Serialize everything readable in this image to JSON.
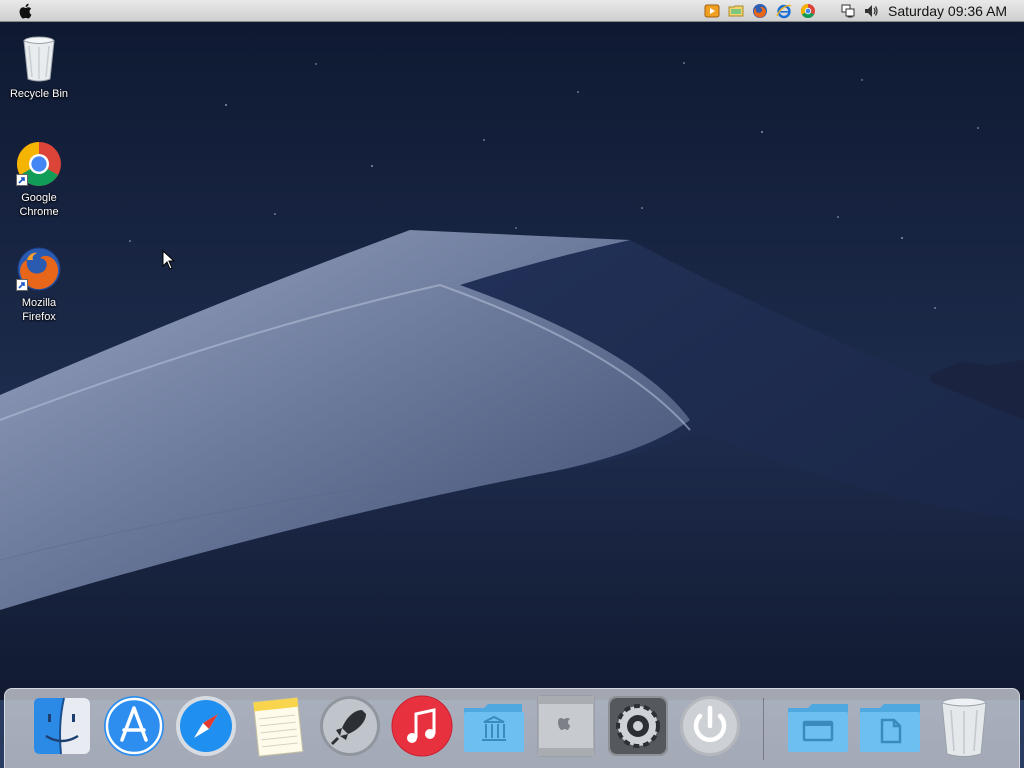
{
  "menubar": {
    "clock": "Saturday 09:36 AM",
    "tray_icons": [
      "media-player-icon",
      "file-manager-icon",
      "firefox-icon",
      "internet-explorer-icon",
      "chrome-icon",
      "network-icon",
      "volume-icon"
    ]
  },
  "desktop": {
    "icons": [
      {
        "label": "Recycle Bin",
        "icon": "recycle-bin-icon"
      },
      {
        "label": "Google Chrome",
        "icon": "chrome-icon",
        "shortcut": true
      },
      {
        "label": "Mozilla Firefox",
        "icon": "firefox-icon",
        "shortcut": true
      }
    ]
  },
  "dock": {
    "items": [
      "finder-icon",
      "app-store-icon",
      "safari-icon",
      "notes-icon",
      "launchpad-icon",
      "itunes-icon",
      "applications-folder-icon",
      "mac-pro-icon",
      "system-preferences-icon",
      "power-icon",
      "desktop-folder-icon",
      "documents-folder-icon",
      "trash-icon"
    ]
  },
  "colors": {
    "sky_top": "#0f1a33",
    "sky_bottom": "#27385c",
    "dune_light": "#8c98b5",
    "dune_shadow": "#1f2c4a",
    "menubar": "#dcdcdc",
    "folder_blue": "#63b7ea"
  }
}
